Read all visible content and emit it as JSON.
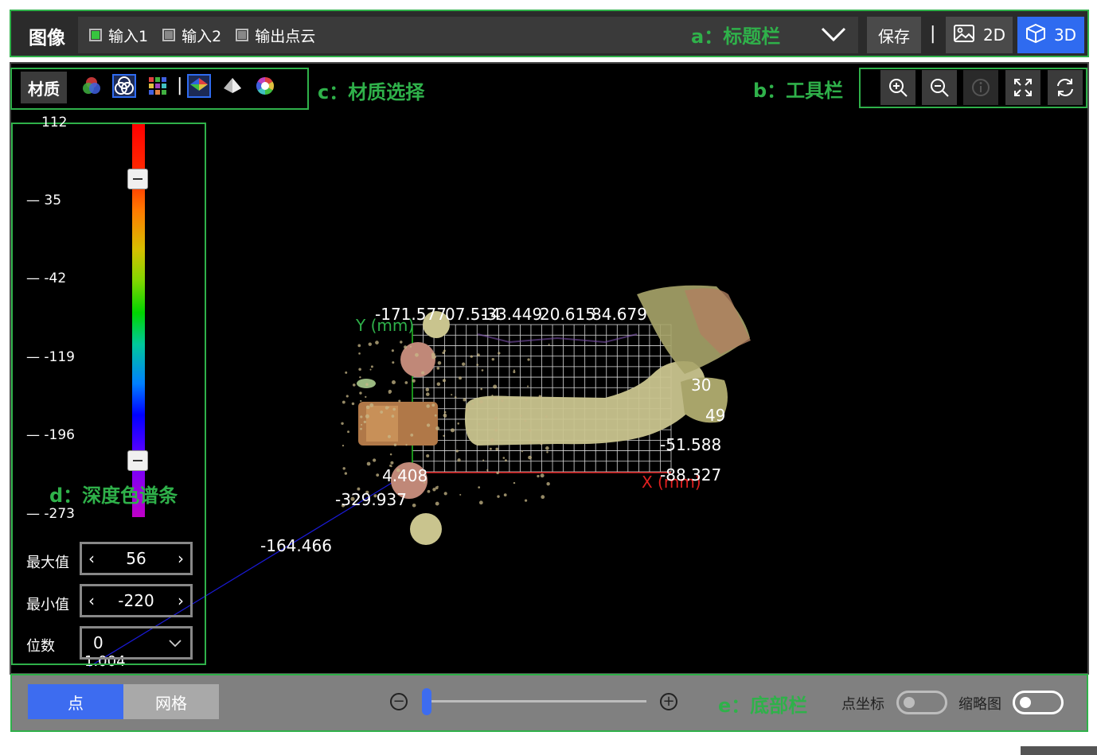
{
  "title_bar": {
    "title": "图像",
    "checkboxes": [
      {
        "label": "输入1",
        "checked": true
      },
      {
        "label": "输入2",
        "checked": false
      },
      {
        "label": "输出点云",
        "checked": false
      }
    ],
    "annotation": "a：标题栏",
    "save_label": "保存",
    "separator": "|",
    "view_2d_label": "2D",
    "view_3d_label": "3D",
    "active_view": "3D"
  },
  "material_bar": {
    "label": "材质",
    "annotation": "c：材质选择",
    "separator": "|",
    "icons": [
      "rgb-circles-icon",
      "rgb-outline-icon",
      "color-grid-icon",
      "depth-cube-icon",
      "gray-shaded-icon",
      "color-wheel-icon"
    ]
  },
  "toolbar": {
    "annotation": "b：工具栏",
    "icons": [
      "zoom-in-icon",
      "zoom-out-icon",
      "info-icon",
      "fit-view-icon",
      "reset-view-icon"
    ]
  },
  "depth_colorbar": {
    "annotation": "d：深度色谱条",
    "ticks": [
      "112",
      "35",
      "-42",
      "-119",
      "-196",
      "-273"
    ],
    "max_label": "最大值",
    "max_value": "56",
    "min_label": "最小值",
    "min_value": "-220",
    "digits_label": "位数",
    "digits_value": "0",
    "colors": [
      "#ff0000",
      "#ff7a00",
      "#7fd600",
      "#00d400",
      "#0080ff",
      "#0000ff",
      "#c000c8"
    ]
  },
  "scene": {
    "axis_y_label": "Y (mm)",
    "axis_x_label": "X (mm)",
    "top_values": [
      "-171.577",
      "07.514",
      "-33.449",
      "20.615",
      "84.679"
    ],
    "right_values": [
      "-51.588",
      "-88.327"
    ],
    "partial_right_1": "30",
    "partial_right_2": "49",
    "origin_value": "4.408",
    "left_value": "-329.937",
    "diag_value": "-164.466",
    "bottom_value": "1.004"
  },
  "bottom_bar": {
    "annotation": "e：底部栏",
    "mode_point": "点",
    "mode_mesh": "网格",
    "active_mode": "点",
    "zoom_minus": "−",
    "zoom_plus": "+",
    "point_coord_label": "点坐标",
    "point_coord_on": false,
    "thumbnail_label": "缩略图",
    "thumbnail_on": false
  }
}
